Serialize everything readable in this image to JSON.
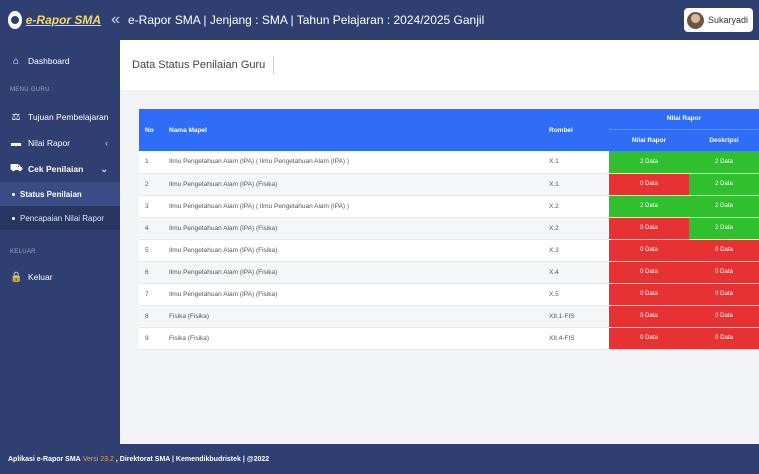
{
  "header": {
    "brand": "e-Rapor SMA",
    "collapse_glyph": "«",
    "title": "e-Rapor SMA | Jenjang : SMA | Tahun Pelajaran : 2024/2025 Ganjil",
    "user_name": "Sukaryadi"
  },
  "sidebar": {
    "dashboard": "Dashboard",
    "section_guru": "MENU GURU :",
    "tujuan": "Tujuan Pembelajaran",
    "nilai_rapor": "Nilai Rapor",
    "cek_penilaian": "Cek Penilaian",
    "status_penilaian": "Status Penilaian",
    "pencapaian": "Pencapaian Nilai Rapor",
    "section_keluar": "KELUAR",
    "keluar": "Keluar"
  },
  "page": {
    "title": "Data Status Penilaian Guru"
  },
  "table": {
    "headers": {
      "no": "No",
      "mapel": "Nama Mapel",
      "rombel": "Rombel",
      "group": "Nilai Rapor",
      "nilai": "Nilai Rapor",
      "deskripsi": "Deskripsi"
    },
    "rows": [
      {
        "no": "1",
        "mapel": "Ilmu Pengetahuan Alam (IPA) ( Ilmu Pengetahuan Alam (IPA) )",
        "rombel": "X.1",
        "nilai": "2 Data",
        "nilai_status": "green",
        "deskripsi": "2 Data",
        "deskripsi_status": "green"
      },
      {
        "no": "2",
        "mapel": "Ilmu Pengetahuan Alam (IPA) (Fisika)",
        "rombel": "X.1",
        "nilai": "0 Data",
        "nilai_status": "red",
        "deskripsi": "2 Data",
        "deskripsi_status": "green"
      },
      {
        "no": "3",
        "mapel": "Ilmu Pengetahuan Alam (IPA) ( Ilmu Pengetahuan Alam (IPA) )",
        "rombel": "X.2",
        "nilai": "2 Data",
        "nilai_status": "green",
        "deskripsi": "2 Data",
        "deskripsi_status": "green"
      },
      {
        "no": "4",
        "mapel": "Ilmu Pengetahuan Alam (IPA) (Fisika)",
        "rombel": "X.2",
        "nilai": "0 Data",
        "nilai_status": "red",
        "deskripsi": "2 Data",
        "deskripsi_status": "green"
      },
      {
        "no": "5",
        "mapel": "Ilmu Pengetahuan Alam (IPA) (Fisika)",
        "rombel": "X.3",
        "nilai": "0 Data",
        "nilai_status": "red",
        "deskripsi": "0 Data",
        "deskripsi_status": "red"
      },
      {
        "no": "6",
        "mapel": "Ilmu Pengetahuan Alam (IPA) (Fisika)",
        "rombel": "X.4",
        "nilai": "0 Data",
        "nilai_status": "red",
        "deskripsi": "0 Data",
        "deskripsi_status": "red"
      },
      {
        "no": "7",
        "mapel": "Ilmu Pengetahuan Alam (IPA) (Fisika)",
        "rombel": "X.5",
        "nilai": "0 Data",
        "nilai_status": "red",
        "deskripsi": "0 Data",
        "deskripsi_status": "red"
      },
      {
        "no": "8",
        "mapel": "Fisika (Fisika)",
        "rombel": "XII.1-FIS",
        "nilai": "0 Data",
        "nilai_status": "red",
        "deskripsi": "0 Data",
        "deskripsi_status": "red"
      },
      {
        "no": "9",
        "mapel": "Fisika (Fisika)",
        "rombel": "XII.4-FIS",
        "nilai": "0 Data",
        "nilai_status": "red",
        "deskripsi": "0 Data",
        "deskripsi_status": "red"
      }
    ]
  },
  "footer": {
    "prefix": "Aplikasi e-Rapor SMA",
    "version": "Versi 23.2",
    "suffix": ", Direktorat SMA | Kemendikbudristek | @2022"
  },
  "colors": {
    "navy": "#2f3f72",
    "table_header": "#2f6df6",
    "green": "#2fbf2f",
    "red": "#e63232"
  }
}
